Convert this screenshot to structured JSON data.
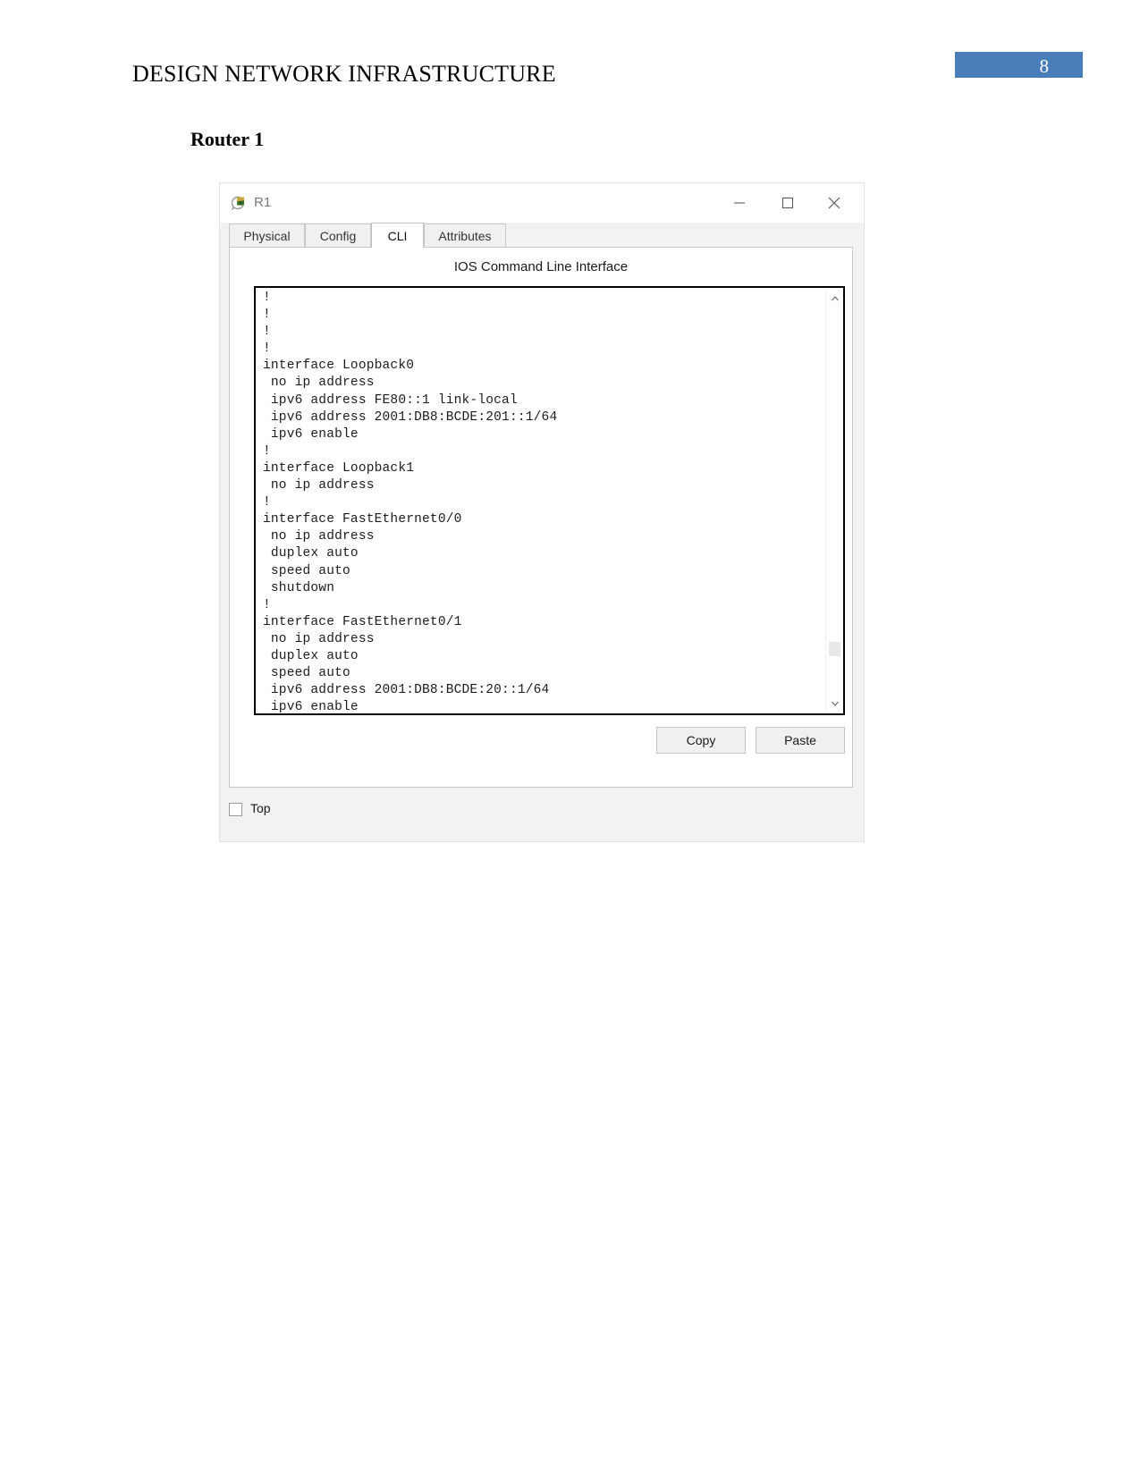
{
  "document": {
    "header_title": "DESIGN NETWORK INFRASTRUCTURE",
    "page_number": "8",
    "section_heading": "Router 1",
    "accent_color": "#4a7ebb"
  },
  "window": {
    "title": "R1",
    "icon": "router-icon",
    "minimize_label": "—",
    "maximize_label": "☐",
    "close_label": "✕"
  },
  "tabs": [
    {
      "label": "Physical",
      "active": false
    },
    {
      "label": "Config",
      "active": false
    },
    {
      "label": "CLI",
      "active": true
    },
    {
      "label": "Attributes",
      "active": false
    }
  ],
  "cli": {
    "caption": "IOS Command Line Interface",
    "terminal_lines": [
      "!",
      "!",
      "!",
      "!",
      "interface Loopback0",
      " no ip address",
      " ipv6 address FE80::1 link-local",
      " ipv6 address 2001:DB8:BCDE:201::1/64",
      " ipv6 enable",
      "!",
      "interface Loopback1",
      " no ip address",
      "!",
      "interface FastEthernet0/0",
      " no ip address",
      " duplex auto",
      " speed auto",
      " shutdown",
      "!",
      "interface FastEthernet0/1",
      " no ip address",
      " duplex auto",
      " speed auto",
      " ipv6 address 2001:DB8:BCDE:20::1/64",
      " ipv6 enable",
      "!"
    ],
    "copy_label": "Copy",
    "paste_label": "Paste"
  },
  "bottom": {
    "top_checkbox_label": "Top",
    "top_checkbox_checked": false
  }
}
